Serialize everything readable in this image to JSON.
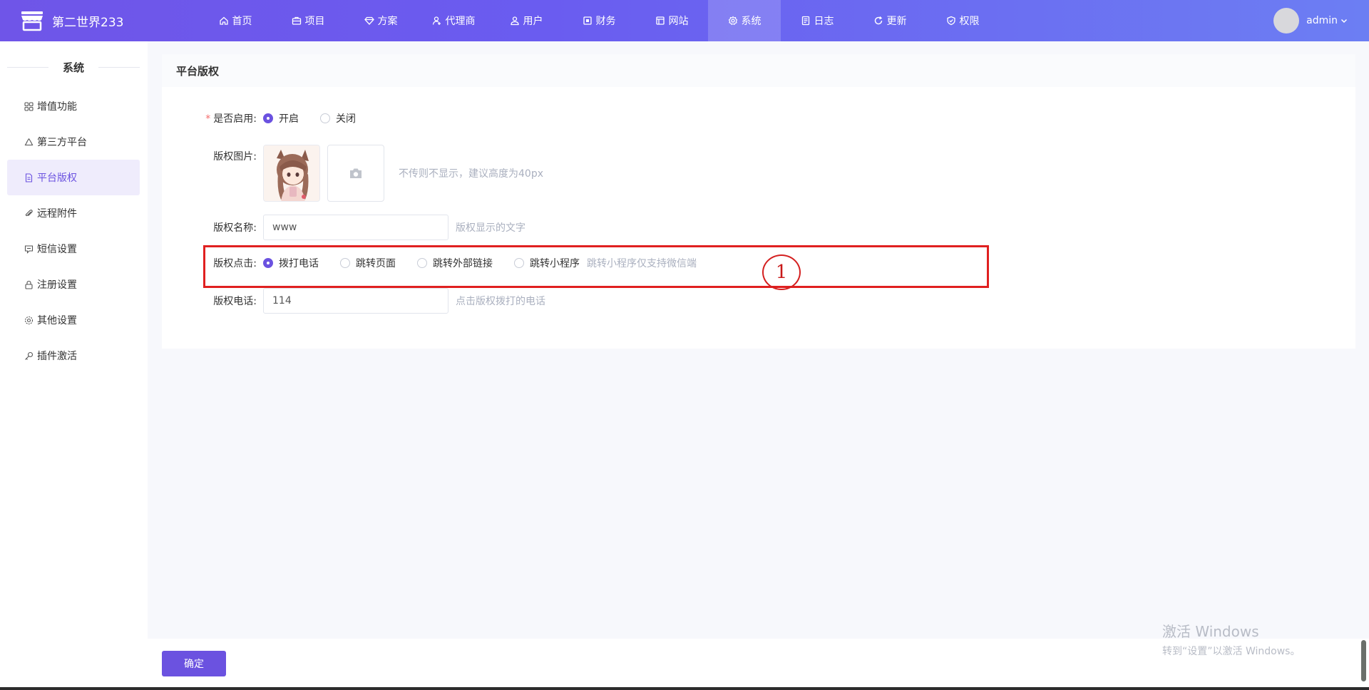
{
  "app": {
    "name": "第二世界233",
    "user": "admin"
  },
  "nav": [
    {
      "label": "首页",
      "icon": "home-icon"
    },
    {
      "label": "项目",
      "icon": "briefcase-icon"
    },
    {
      "label": "方案",
      "icon": "diamond-icon"
    },
    {
      "label": "代理商",
      "icon": "agent-icon"
    },
    {
      "label": "用户",
      "icon": "users-icon"
    },
    {
      "label": "财务",
      "icon": "finance-icon"
    },
    {
      "label": "网站",
      "icon": "website-icon"
    },
    {
      "label": "系统",
      "icon": "gear-icon",
      "active": true
    },
    {
      "label": "日志",
      "icon": "log-icon"
    },
    {
      "label": "更新",
      "icon": "refresh-icon"
    },
    {
      "label": "权限",
      "icon": "shield-icon"
    }
  ],
  "sidebar": {
    "title": "系统",
    "items": [
      {
        "label": "增值功能",
        "icon": "grid-icon"
      },
      {
        "label": "第三方平台",
        "icon": "recycle-icon"
      },
      {
        "label": "平台版权",
        "icon": "document-icon",
        "active": true
      },
      {
        "label": "远程附件",
        "icon": "paperclip-icon"
      },
      {
        "label": "短信设置",
        "icon": "message-icon"
      },
      {
        "label": "注册设置",
        "icon": "lock-icon"
      },
      {
        "label": "其他设置",
        "icon": "settings-icon"
      },
      {
        "label": "插件激活",
        "icon": "key-icon"
      }
    ]
  },
  "page": {
    "title": "平台版权",
    "enable": {
      "label": "是否启用:",
      "required_mark": "*",
      "options": [
        "开启",
        "关闭"
      ],
      "selected": "开启"
    },
    "image": {
      "label": "版权图片:",
      "hint": "不传则不显示，建议高度为40px"
    },
    "name": {
      "label": "版权名称:",
      "value": "www",
      "hint": "版权显示的文字"
    },
    "click": {
      "label": "版权点击:",
      "options": [
        "拨打电话",
        "跳转页面",
        "跳转外部链接",
        "跳转小程序"
      ],
      "selected": "拨打电话",
      "hint": "跳转小程序仅支持微信端"
    },
    "phone": {
      "label": "版权电话:",
      "value": "114",
      "hint": "点击版权拨打的电话"
    },
    "annotation_number": "1"
  },
  "footer": {
    "confirm": "确定"
  },
  "watermark": {
    "line1": "激活 Windows",
    "line2": "转到“设置”以激活 Windows。"
  },
  "colors": {
    "accent": "#6b52e0",
    "annotation": "#e02020"
  }
}
